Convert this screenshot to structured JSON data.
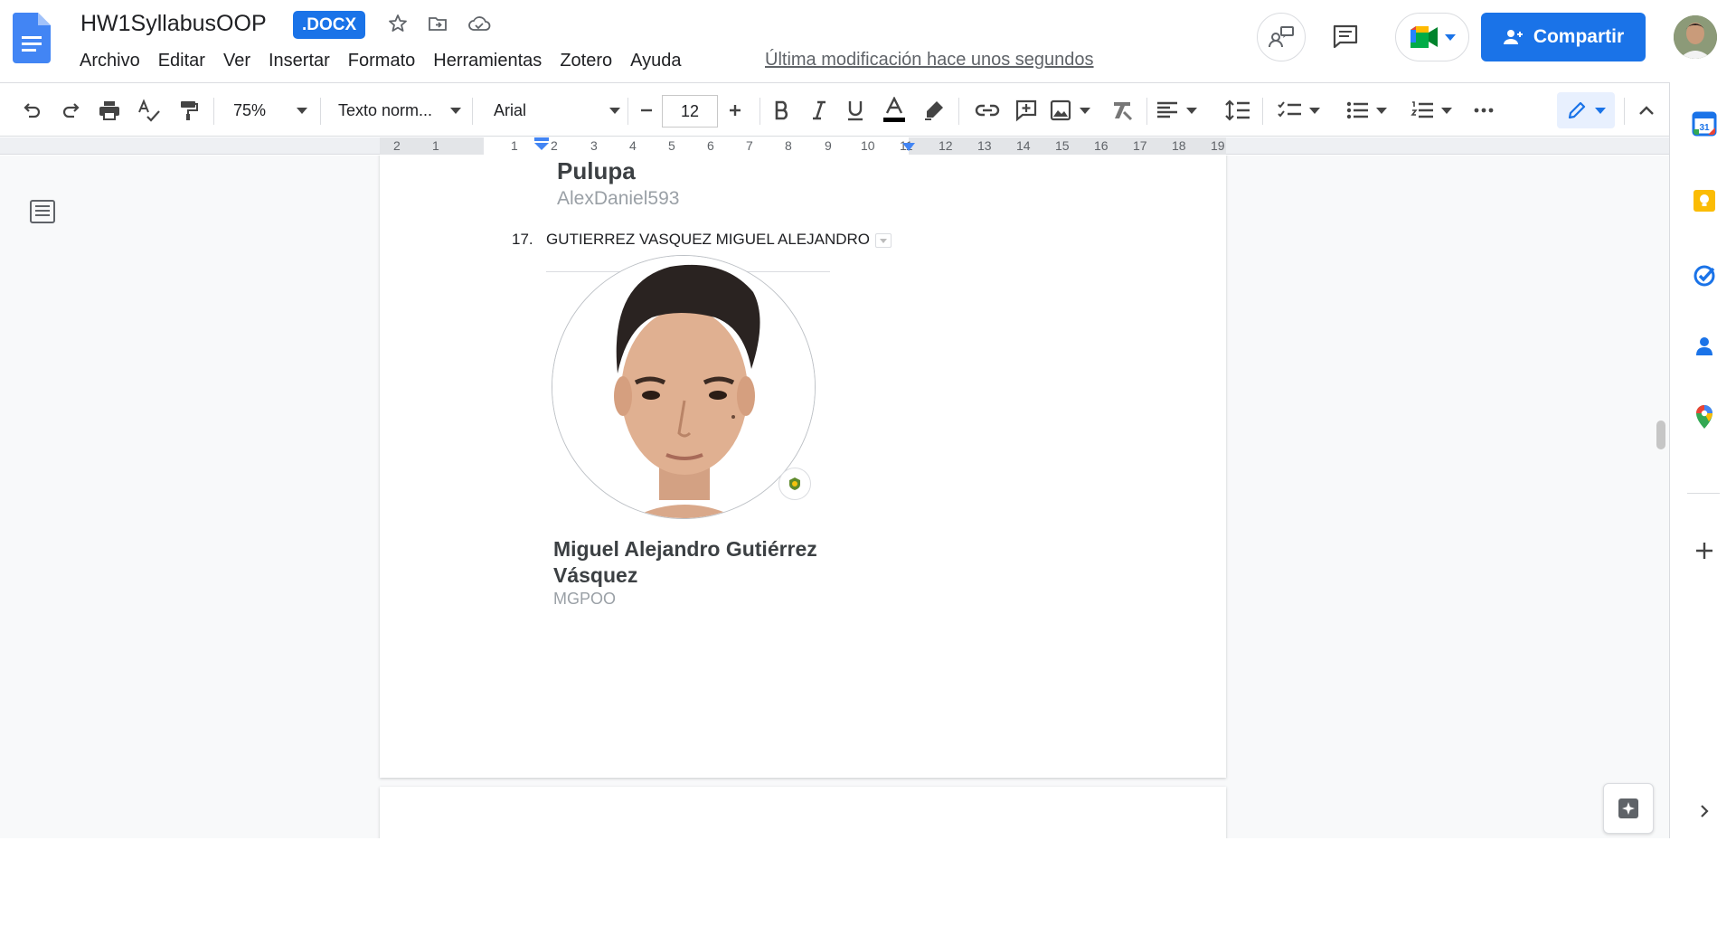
{
  "header": {
    "doc_title": "HW1SyllabusOOP",
    "format_badge": ".DOCX",
    "menu": [
      "Archivo",
      "Editar",
      "Ver",
      "Insertar",
      "Formato",
      "Herramientas",
      "Zotero",
      "Ayuda"
    ],
    "last_edit": "Última modificación hace unos segundos",
    "share_label": "Compartir"
  },
  "toolbar": {
    "zoom": "75%",
    "style": "Texto norm...",
    "font": "Arial",
    "font_size": "12"
  },
  "ruler": {
    "labels": [
      "2",
      "1",
      "1",
      "2",
      "3",
      "4",
      "5",
      "6",
      "7",
      "8",
      "9",
      "10",
      "11",
      "12",
      "13",
      "14",
      "15",
      "16",
      "17",
      "18",
      "19"
    ]
  },
  "document": {
    "prev_name": "Pulupa",
    "prev_user": "AlexDaniel593",
    "list_number": "17.",
    "list_text": "GUTIERREZ VASQUEZ MIGUEL ALEJANDRO",
    "person_name": "Miguel Alejandro Gutiérrez Vásquez",
    "person_user": "MGPOO"
  },
  "colors": {
    "accent": "#1a73e8",
    "text": "#202124",
    "muted": "#9aa0a6"
  },
  "icons": {
    "side_panel": [
      "calendar-icon",
      "keep-icon",
      "tasks-icon",
      "contacts-icon",
      "maps-icon",
      "add-icon"
    ]
  }
}
